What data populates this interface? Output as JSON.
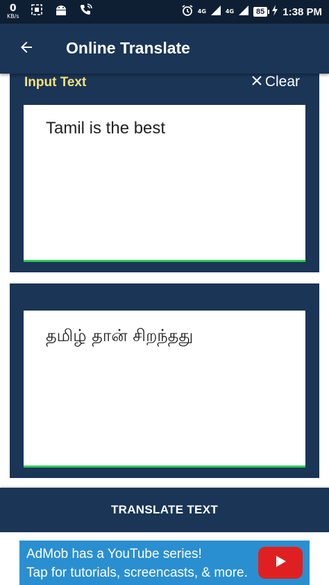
{
  "status_bar": {
    "speed_value": "0",
    "speed_unit": "KB/s",
    "net1": "4G",
    "net2": "4G",
    "battery": "85",
    "time": "1:38 PM"
  },
  "appbar": {
    "title": "Online Translate"
  },
  "input_card": {
    "label": "Input Text",
    "clear_label": "Clear",
    "text": "Tamil is the best"
  },
  "output_card": {
    "text": "தமிழ் தான் சிறந்தது"
  },
  "translate_button": {
    "label": "TRANSLATE TEXT"
  },
  "ad": {
    "line1": "AdMob has a YouTube series!",
    "line2": "Tap for tutorials, screencasts, & more."
  },
  "colors": {
    "primary": "#1a3556",
    "status_bar": "#0f1f33",
    "label_yellow": "#f6e27a",
    "underline_green": "#2ecc5a",
    "ad_blue": "#2a8fd0",
    "youtube_red": "#e02020"
  },
  "icons": [
    "screenshot-icon",
    "android-icon",
    "wifi-calling-icon",
    "alarm-icon",
    "signal-icon",
    "battery-icon",
    "back-arrow-icon",
    "close-icon",
    "play-icon"
  ]
}
